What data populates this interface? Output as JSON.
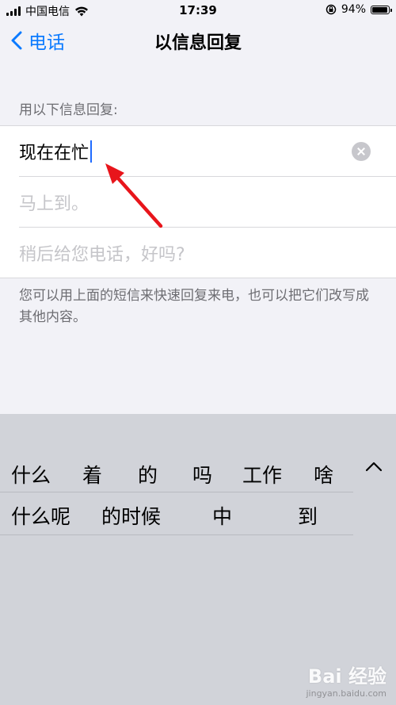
{
  "status_bar": {
    "carrier": "中国电信",
    "time": "17:39",
    "battery_percent": "94%",
    "battery_level": 0.94
  },
  "nav": {
    "back_label": "电话",
    "title": "以信息回复"
  },
  "section_header": "用以下信息回复:",
  "replies": [
    {
      "text": "现在在忙",
      "placeholder": ""
    },
    {
      "text": "",
      "placeholder": "马上到。"
    },
    {
      "text": "",
      "placeholder": "稍后给您电话，好吗?"
    }
  ],
  "footer": "您可以用上面的短信来快速回复来电，也可以把它们改写成其他内容。",
  "keyboard": {
    "candidates_row1": [
      "什么",
      "着",
      "的",
      "吗",
      "工作",
      "啥"
    ],
    "candidates_row2": [
      "什么呢",
      "的时候",
      "中",
      "到"
    ]
  },
  "watermark": {
    "brand": "Bai 经验",
    "site": "jingyan.baidu.com"
  },
  "colors": {
    "accent": "#0a7aff",
    "arrow": "#e8151b",
    "cursor": "#1f6bff"
  }
}
